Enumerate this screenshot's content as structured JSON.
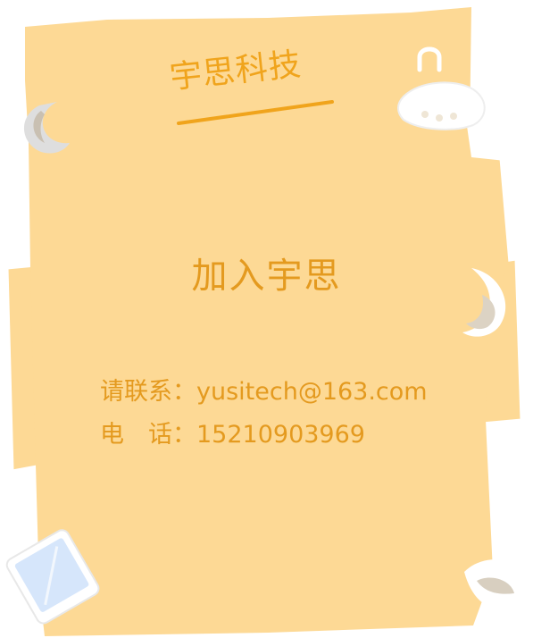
{
  "logo": {
    "text": "宇思科技"
  },
  "heading": {
    "text": "加入宇思"
  },
  "contact": {
    "email": {
      "label": "请联系",
      "separator": "：",
      "value": "yusitech@163.com"
    },
    "phone": {
      "label": "电　话",
      "separator": "：",
      "value": "15210903969"
    }
  },
  "colors": {
    "paper": "#fdd995",
    "accent": "#f0a41c",
    "text": "#e49a1f"
  },
  "icons": [
    "tablet-icon",
    "tooth-icon",
    "moon-crescent-icon"
  ]
}
